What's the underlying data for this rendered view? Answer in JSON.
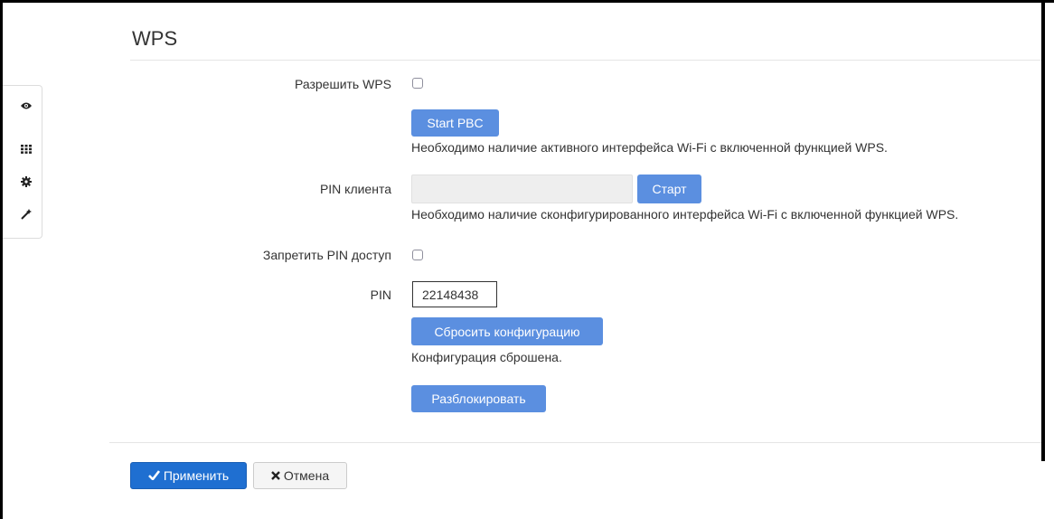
{
  "page": {
    "title": "WPS"
  },
  "side_toolbar": {
    "icons": [
      "eye-icon",
      "grid-icon",
      "gear-icon",
      "wand-icon"
    ]
  },
  "form": {
    "enable_wps": {
      "label": "Разрешить WPS",
      "checked": false
    },
    "start_pbc": {
      "button_label": "Start PBC",
      "help": "Необходимо наличие активного интерфейса Wi-Fi с включенной функцией WPS."
    },
    "client_pin": {
      "label": "PIN клиента",
      "value": "",
      "button_label": "Старт",
      "help": "Необходимо наличие сконфигурированного интерфейса Wi-Fi с включенной функцией WPS."
    },
    "deny_pin": {
      "label": "Запретить PIN доступ",
      "checked": false
    },
    "pin": {
      "label": "PIN",
      "value": "22148438"
    },
    "reset": {
      "button_label": "Сбросить конфигурацию",
      "status": "Конфигурация сброшена."
    },
    "unlock": {
      "button_label": "Разблокировать"
    }
  },
  "footer": {
    "apply_label": "Применить",
    "cancel_label": "Отмена"
  },
  "colors": {
    "primary_button": "#5b8fe0",
    "apply_button": "#1f6fd1"
  }
}
